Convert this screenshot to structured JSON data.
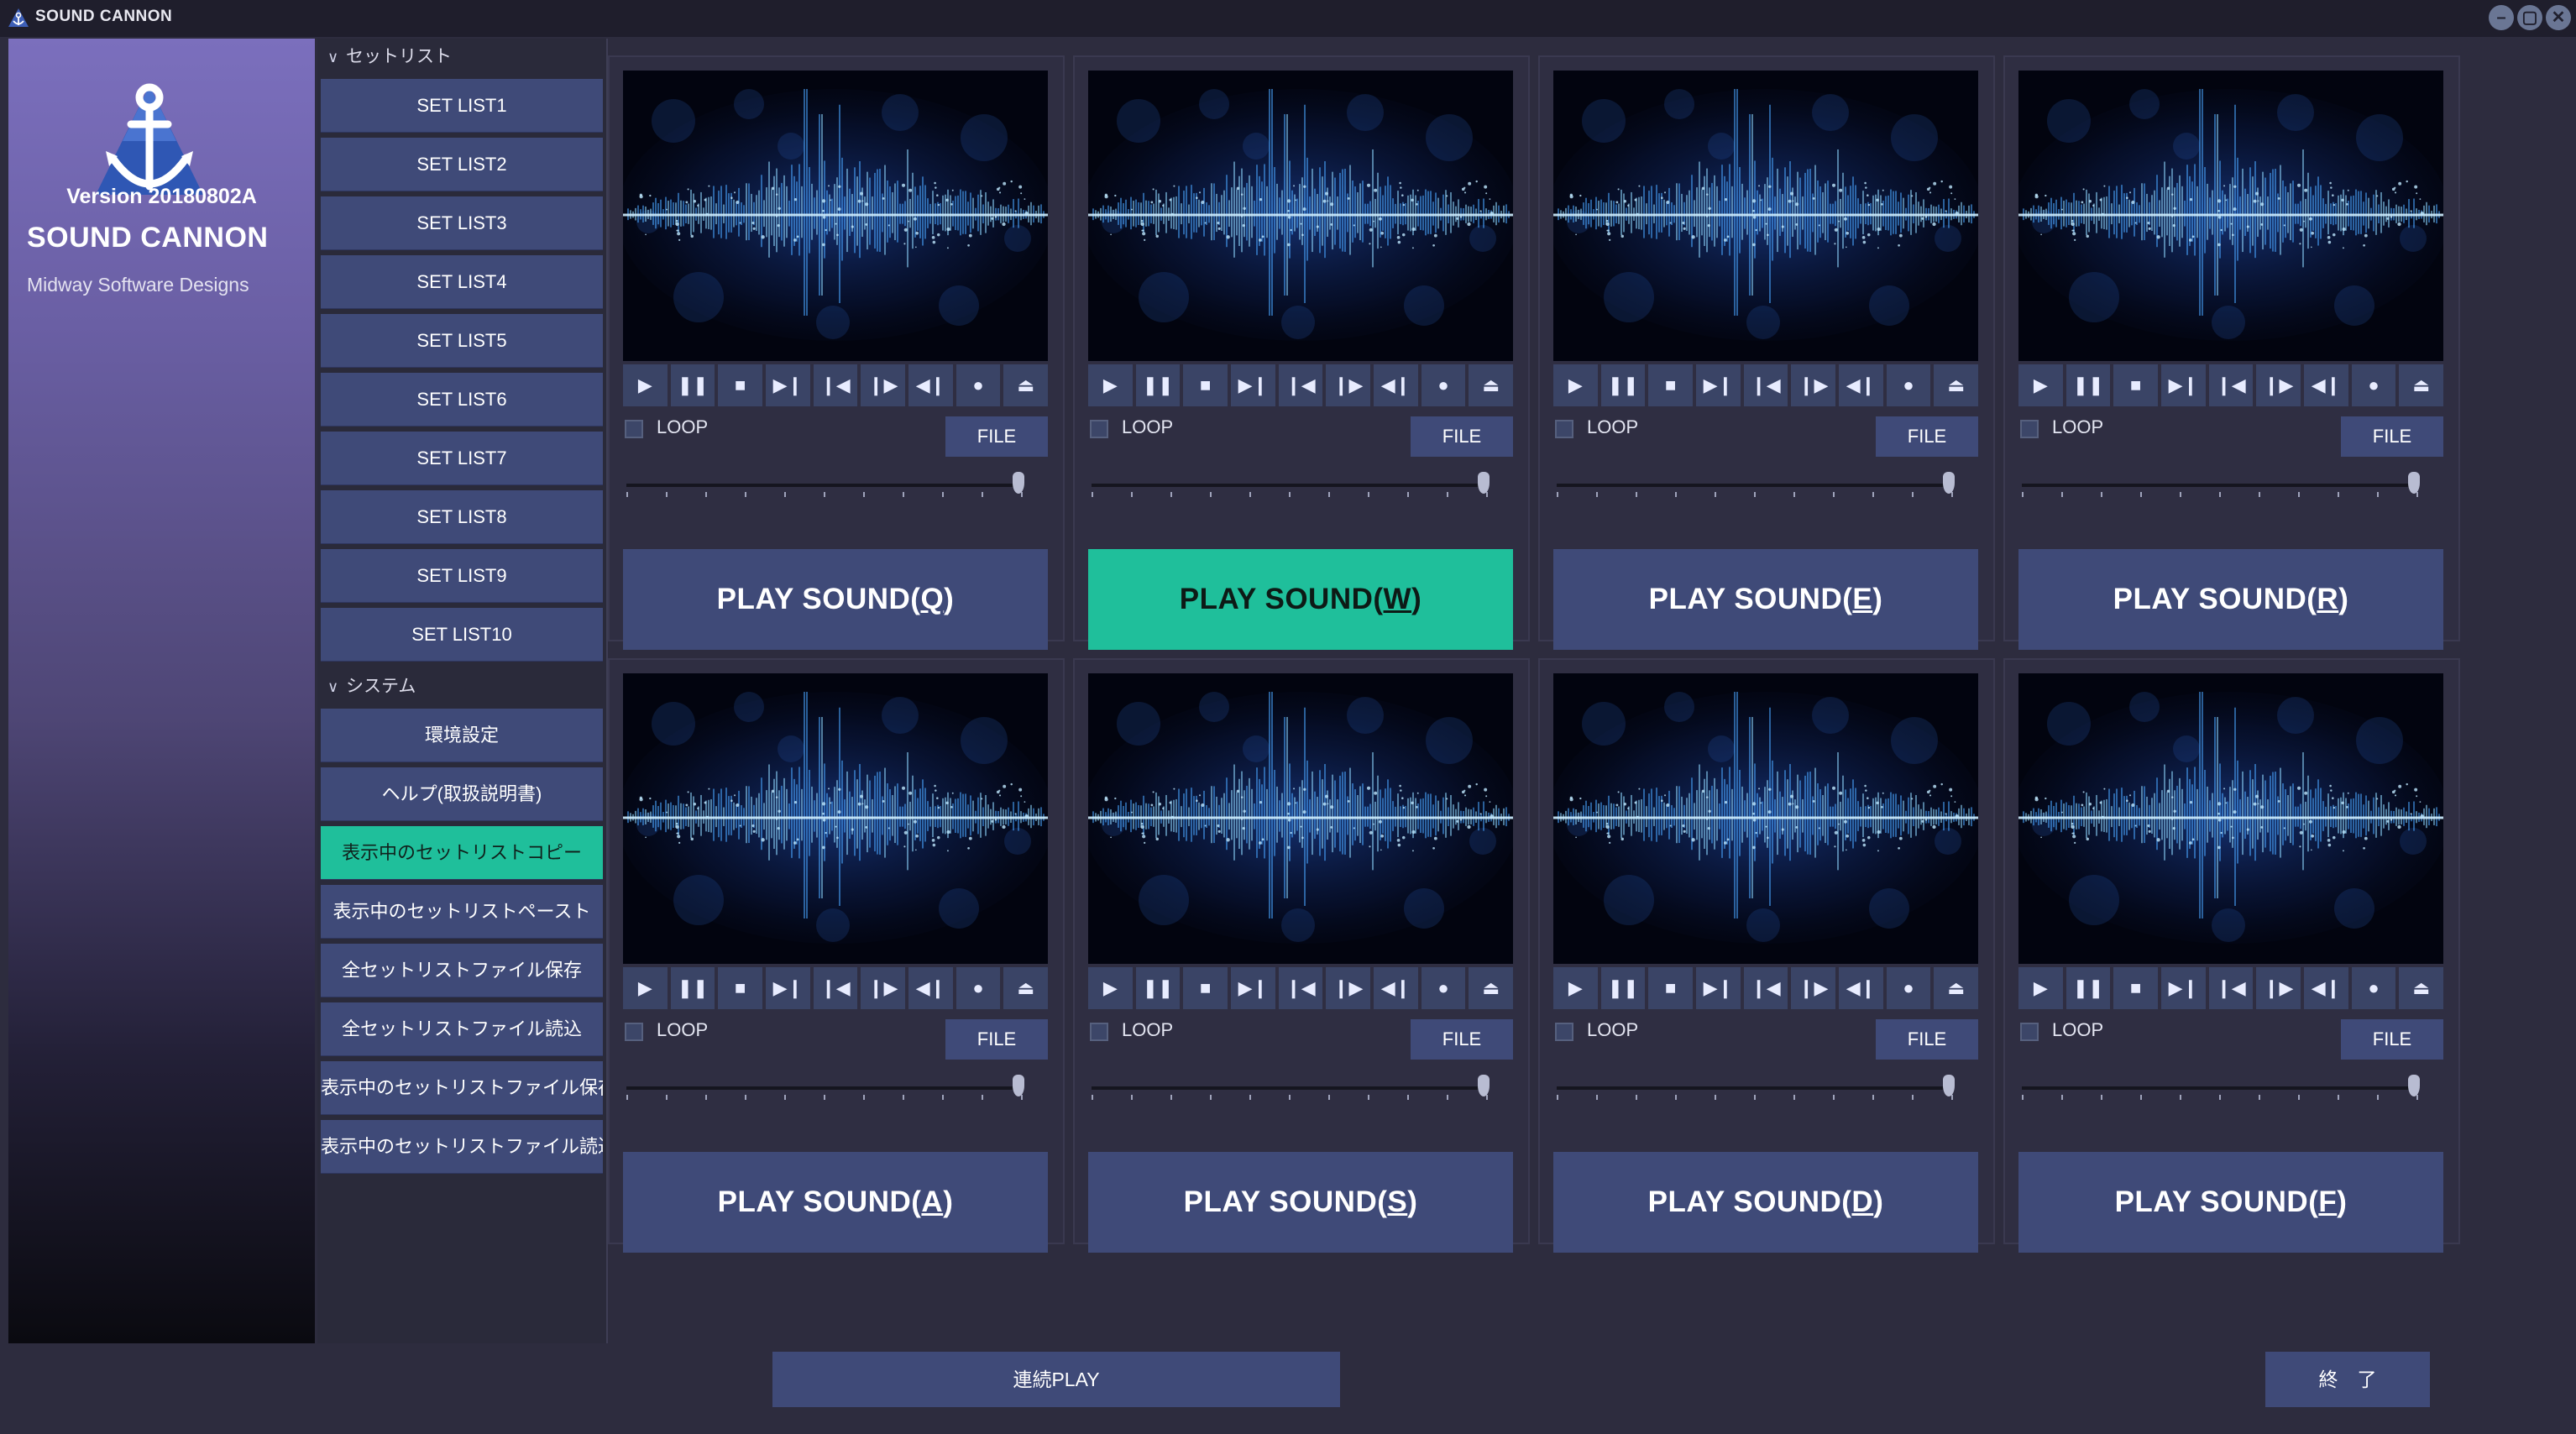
{
  "window": {
    "title": "SOUND CANNON",
    "controls": [
      {
        "icon": "minimize-icon",
        "glyph": "–"
      },
      {
        "icon": "maximize-icon",
        "glyph": "▢"
      },
      {
        "icon": "close-icon",
        "glyph": "✕"
      }
    ]
  },
  "brand": {
    "version": "Version 20180802A",
    "name": "SOUND CANNON",
    "company": "Midway Software Designs"
  },
  "sidebar": {
    "setlist_header": "セットリスト",
    "setlists": [
      "SET LIST1",
      "SET LIST2",
      "SET LIST3",
      "SET LIST4",
      "SET LIST5",
      "SET LIST6",
      "SET LIST7",
      "SET LIST8",
      "SET LIST9",
      "SET LIST10"
    ],
    "system_header": "システム",
    "system_items": [
      {
        "label": "環境設定",
        "active": false
      },
      {
        "label": "ヘルプ(取扱説明書)",
        "active": false
      },
      {
        "label": "表示中のセットリストコピー",
        "active": true
      },
      {
        "label": "表示中のセットリストペースト",
        "active": false
      },
      {
        "label": "全セットリストファイル保存",
        "active": false
      },
      {
        "label": "全セットリストファイル読込",
        "active": false
      },
      {
        "label": "表示中のセットリストファイル保存",
        "active": false
      },
      {
        "label": "表示中のセットリストファイル読込",
        "active": false
      }
    ]
  },
  "player_controls": [
    {
      "icon": "play-icon",
      "glyph": "▶"
    },
    {
      "icon": "pause-icon",
      "glyph": "❚❚"
    },
    {
      "icon": "stop-icon",
      "glyph": "■"
    },
    {
      "icon": "step-forward-icon",
      "glyph": "▶❙"
    },
    {
      "icon": "skip-back-icon",
      "glyph": "❙◀"
    },
    {
      "icon": "forward-icon",
      "glyph": "❙▶"
    },
    {
      "icon": "rewind-icon",
      "glyph": "◀❙"
    },
    {
      "icon": "record-icon",
      "glyph": "●"
    },
    {
      "icon": "eject-icon",
      "glyph": "⏏"
    }
  ],
  "slots": [
    {
      "key": "Q",
      "before": "PLAY SOUND(",
      "after": ")",
      "loop_label": "LOOP",
      "file_label": "FILE",
      "active": false
    },
    {
      "key": "W",
      "before": "PLAY SOUND(",
      "after": ")",
      "loop_label": "LOOP",
      "file_label": "FILE",
      "active": true
    },
    {
      "key": "E",
      "before": "PLAY SOUND(",
      "after": ")",
      "loop_label": "LOOP",
      "file_label": "FILE",
      "active": false
    },
    {
      "key": "R",
      "before": "PLAY SOUND(",
      "after": ")",
      "loop_label": "LOOP",
      "file_label": "FILE",
      "active": false
    },
    {
      "key": "A",
      "before": "PLAY SOUND(",
      "after": ")",
      "loop_label": "LOOP",
      "file_label": "FILE",
      "active": false
    },
    {
      "key": "S",
      "before": "PLAY SOUND(",
      "after": ")",
      "loop_label": "LOOP",
      "file_label": "FILE",
      "active": false
    },
    {
      "key": "D",
      "before": "PLAY SOUND(",
      "after": ")",
      "loop_label": "LOOP",
      "file_label": "FILE",
      "active": false
    },
    {
      "key": "F",
      "before": "PLAY SOUND(",
      "after": ")",
      "loop_label": "LOOP",
      "file_label": "FILE",
      "active": false
    }
  ],
  "footer": {
    "continuous_play": "連続PLAY",
    "exit": "終　了"
  },
  "colors": {
    "accent": "#1fbf9b",
    "button": "#3f4a78",
    "background": "#2d2c3e"
  }
}
